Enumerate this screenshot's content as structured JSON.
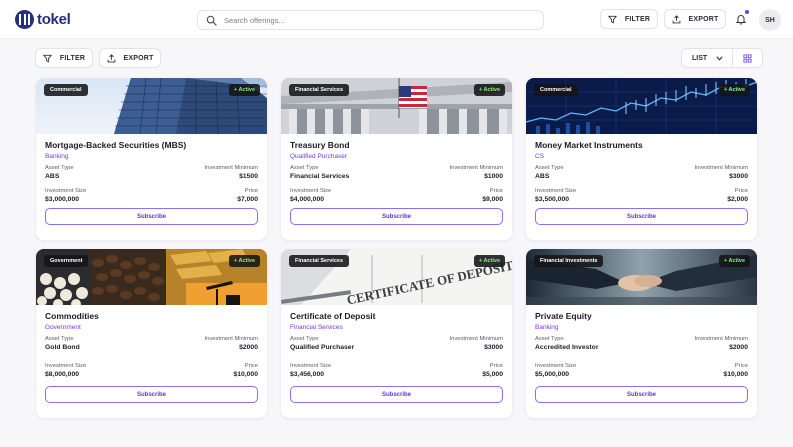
{
  "brand": {
    "name": "tokel",
    "color": "#26307a"
  },
  "accent": "#6a3de8",
  "search": {
    "placeholder": "Search offerings...",
    "value": ""
  },
  "header": {
    "filter_label": "FILTER",
    "export_label": "EXPORT",
    "avatar_initials": "SH",
    "notification_dot": true
  },
  "toolbar": {
    "filter_label": "FILTER",
    "export_label": "EXPORT",
    "view_mode": "LIST"
  },
  "labels": {
    "asset_type": "Asset Type",
    "investment_minimum": "Investment Minimum",
    "investment_size": "Investment Size",
    "price": "Price",
    "subscribe": "Subscribe"
  },
  "cards": [
    {
      "tag": "Commercial",
      "status": "+ Active",
      "title": "Mortgage-Backed Securities (MBS)",
      "subtitle": "Banking",
      "asset_type": "ABS",
      "investment_minimum": "$1500",
      "investment_size": "$3,000,000",
      "price": "$7,000",
      "image": "glass-office-building"
    },
    {
      "tag": "Financial Services",
      "status": "+ Active",
      "title": "Treasury Bond",
      "subtitle": "Qualified Purchaser",
      "asset_type": "Financial Services",
      "investment_minimum": "$1000",
      "investment_size": "$4,000,000",
      "price": "$9,000",
      "image": "us-treasury-building-flag"
    },
    {
      "tag": "Commercial",
      "status": "+ Active",
      "title": "Money Market Instruments",
      "subtitle": "CS",
      "asset_type": "ABS",
      "investment_minimum": "$3000",
      "investment_size": "$3,500,000",
      "price": "$2,000",
      "image": "stock-chart"
    },
    {
      "tag": "Government",
      "status": "+ Active",
      "title": "Commodities",
      "subtitle": "Government",
      "asset_type": "Gold Bond",
      "investment_minimum": "$2000",
      "investment_size": "$8,000,000",
      "price": "$10,000",
      "image": "commodities-collage"
    },
    {
      "tag": "Financial Services",
      "status": "+ Active",
      "title": "Certificate of Deposit",
      "subtitle": "Financial Services",
      "asset_type": "Qualified Purchaser",
      "investment_minimum": "$3000",
      "investment_size": "$3,456,000",
      "price": "$5,000",
      "image": "certificate-document",
      "image_text": "CERTIFICATE OF DEPOSIT"
    },
    {
      "tag": "Financial Investments",
      "status": "+ Active",
      "title": "Private Equity",
      "subtitle": "Banking",
      "asset_type": "Accredited Investor",
      "investment_minimum": "$2000",
      "investment_size": "$5,000,000",
      "price": "$10,000",
      "image": "handshake"
    }
  ]
}
